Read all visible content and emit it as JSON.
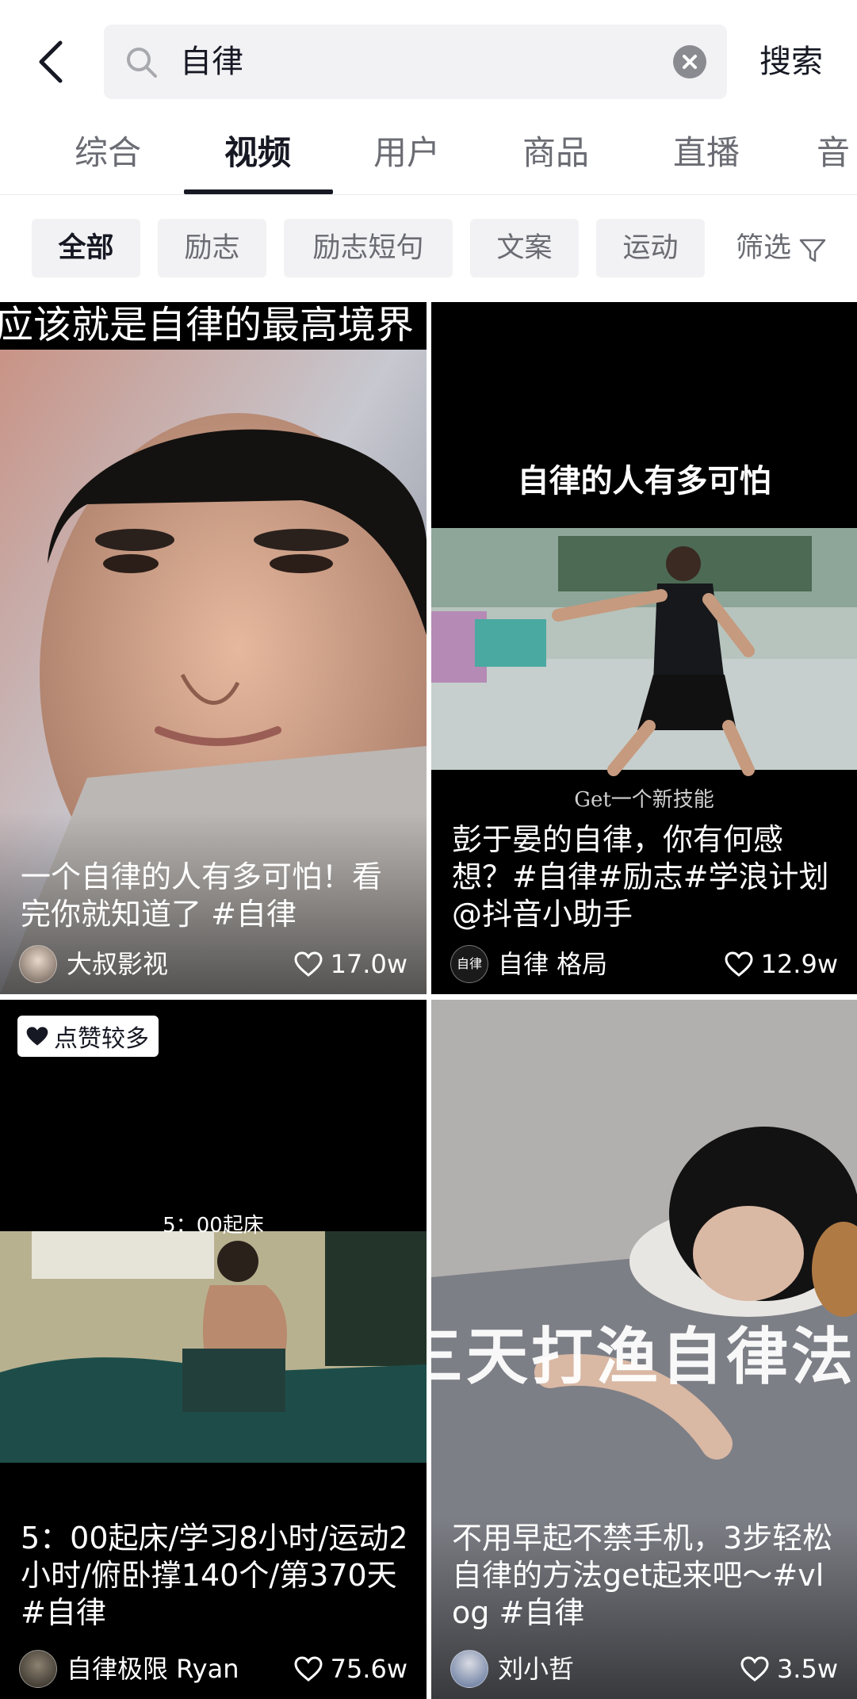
{
  "search": {
    "query": "自律",
    "submit_label": "搜索"
  },
  "tabs": [
    {
      "label": "综合"
    },
    {
      "label": "视频"
    },
    {
      "label": "用户"
    },
    {
      "label": "商品"
    },
    {
      "label": "直播"
    },
    {
      "label": "音"
    }
  ],
  "active_tab": "视频",
  "filters": [
    {
      "label": "全部"
    },
    {
      "label": "励志"
    },
    {
      "label": "励志短句"
    },
    {
      "label": "文案"
    },
    {
      "label": "运动"
    }
  ],
  "filter_button_label": "筛选",
  "videos": [
    {
      "overlay_caption": "应该就是自律的最高境界",
      "title": "一个自律的人有多可怕！看完你就知道了 #自律",
      "author": "大叔影视",
      "likes": "17.0w"
    },
    {
      "overlay_caption": "自律的人有多可怕",
      "overlay_subcaption": "Get一个新技能",
      "title": "彭于晏的自律，你有何感想？#自律#励志#学浪计划 @抖音小助手",
      "author": "自律 格局",
      "author_avatar_text": "自律",
      "likes": "12.9w"
    },
    {
      "badge": "点赞较多",
      "overlay_caption": "5：00起床",
      "title": "5：00起床/学习8小时/运动2小时/俯卧撑140个/第370天#自律",
      "author": "自律极限 Ryan",
      "likes": "75.6w"
    },
    {
      "overlay_caption": "三天打渔自律法",
      "title": "不用早起不禁手机，3步轻松自律的方法get起来吧～#vlog #自律",
      "author": "刘小哲",
      "likes": "3.5w"
    }
  ],
  "colors": {
    "primary_text": "#161823",
    "secondary_text": "#6b6c73",
    "chip_bg": "#f2f2f4",
    "search_bg": "#f2f2f4"
  }
}
